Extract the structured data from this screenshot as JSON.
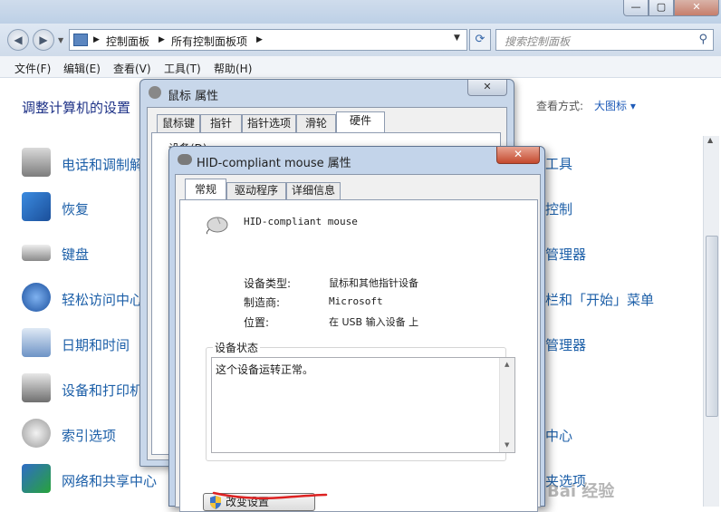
{
  "address_bar": {
    "crumbs": [
      "控制面板",
      "所有控制面板项"
    ],
    "search_placeholder": "搜索控制面板"
  },
  "menu": [
    "文件(F)",
    "编辑(E)",
    "查看(V)",
    "工具(T)",
    "帮助(H)"
  ],
  "control_panel": {
    "heading": "调整计算机的设置",
    "view_by_label": "查看方式:",
    "view_by_value": "大图标 ▾",
    "left_items": [
      {
        "label": "电话和调制解",
        "icon": "phone-modem-icon"
      },
      {
        "label": "恢复",
        "icon": "recovery-icon"
      },
      {
        "label": "键盘",
        "icon": "keyboard-icon"
      },
      {
        "label": "轻松访问中心",
        "icon": "ease-of-access-icon"
      },
      {
        "label": "日期和时间",
        "icon": "calendar-icon"
      },
      {
        "label": "设备和打印机",
        "icon": "printer-icon"
      },
      {
        "label": "索引选项",
        "icon": "search-magnifier-icon"
      },
      {
        "label": "网络和共享中心",
        "icon": "network-icon"
      }
    ],
    "right_items": [
      "工具",
      "控制",
      "管理器",
      "栏和「开始」菜单",
      "管理器",
      "中心",
      "夹选项"
    ]
  },
  "mouse_dialog": {
    "title": "鼠标 属性",
    "tabs": [
      "鼠标键",
      "指针",
      "指针选项",
      "滑轮",
      "硬件"
    ],
    "active_tab": "硬件",
    "device_label": "设备(D):"
  },
  "hid_dialog": {
    "title": "HID-compliant mouse 属性",
    "close": "✕",
    "tabs": [
      "常规",
      "驱动程序",
      "详细信息"
    ],
    "active_tab": "常规",
    "device_name": "HID-compliant mouse",
    "properties": [
      {
        "label": "设备类型:",
        "value": "鼠标和其他指针设备"
      },
      {
        "label": "制造商:",
        "value": "Microsoft"
      },
      {
        "label": "位置:",
        "value": "在 USB 输入设备 上"
      }
    ],
    "status_legend": "设备状态",
    "status_text": "这个设备运转正常。",
    "change_settings_button": "改变设置"
  },
  "watermark": "Bai 经验",
  "colors": {
    "link_blue": "#1c5fa8",
    "heading_blue": "#1e3287",
    "annotation_red": "#d22"
  }
}
